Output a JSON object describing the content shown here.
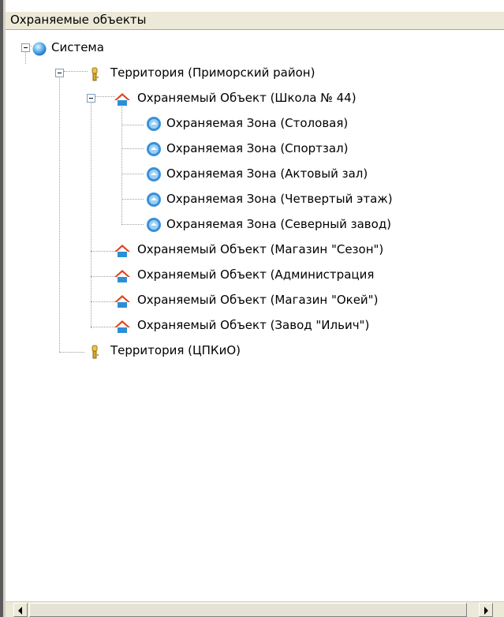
{
  "panel": {
    "title": "Охраняемые объекты"
  },
  "tree": {
    "system": "Система",
    "territory_1": "Территория (Приморский район)",
    "object_school": "Охраняемый Объект (Школа № 44)",
    "zones": [
      "Охраняемая Зона (Столовая)",
      "Охраняемая Зона (Спортзал)",
      "Охраняемая Зона (Актовый зал)",
      "Охраняемая Зона (Четвертый этаж)",
      "Охраняемая Зона (Северный завод)"
    ],
    "objects": [
      "Охраняемый Объект (Магазин \"Сезон\")",
      "Охраняемый Объект (Администрация",
      "Охраняемый Объект (Магазин \"Окей\")",
      "Охраняемый Объект (Завод \"Ильич\")"
    ],
    "territory_2": "Территория (ЦПКиО)"
  },
  "icons": {
    "system": "globe-icon",
    "territory": "key-icon",
    "object": "house-icon",
    "zone": "zone-icon"
  }
}
